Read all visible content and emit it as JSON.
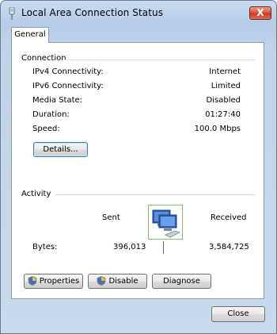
{
  "window": {
    "title": "Local Area Connection Status",
    "close_label": "X"
  },
  "tabs": [
    {
      "label": "General"
    }
  ],
  "connection": {
    "heading": "Connection",
    "rows": [
      {
        "label": "IPv4 Connectivity:",
        "value": "Internet"
      },
      {
        "label": "IPv6 Connectivity:",
        "value": "Limited"
      },
      {
        "label": "Media State:",
        "value": "Disabled"
      },
      {
        "label": "Duration:",
        "value": "01:27:40"
      },
      {
        "label": "Speed:",
        "value": "100.0 Mbps"
      }
    ],
    "details_button": "Details..."
  },
  "activity": {
    "heading": "Activity",
    "sent_label": "Sent",
    "received_label": "Received",
    "bytes_label": "Bytes:",
    "bytes_sent": "396,013",
    "bytes_received": "3,584,725"
  },
  "actions": {
    "properties": "Properties",
    "disable": "Disable",
    "diagnose": "Diagnose"
  },
  "footer": {
    "close": "Close"
  },
  "icons": {
    "title": "network-adapter-icon",
    "activity": "network-computers-icon",
    "uac": "uac-shield-icon"
  },
  "colors": {
    "titlebar": "#b6cde8",
    "close_button": "#c63a22",
    "panel_bg": "#ffffff",
    "divider": "#d5dbe3"
  }
}
